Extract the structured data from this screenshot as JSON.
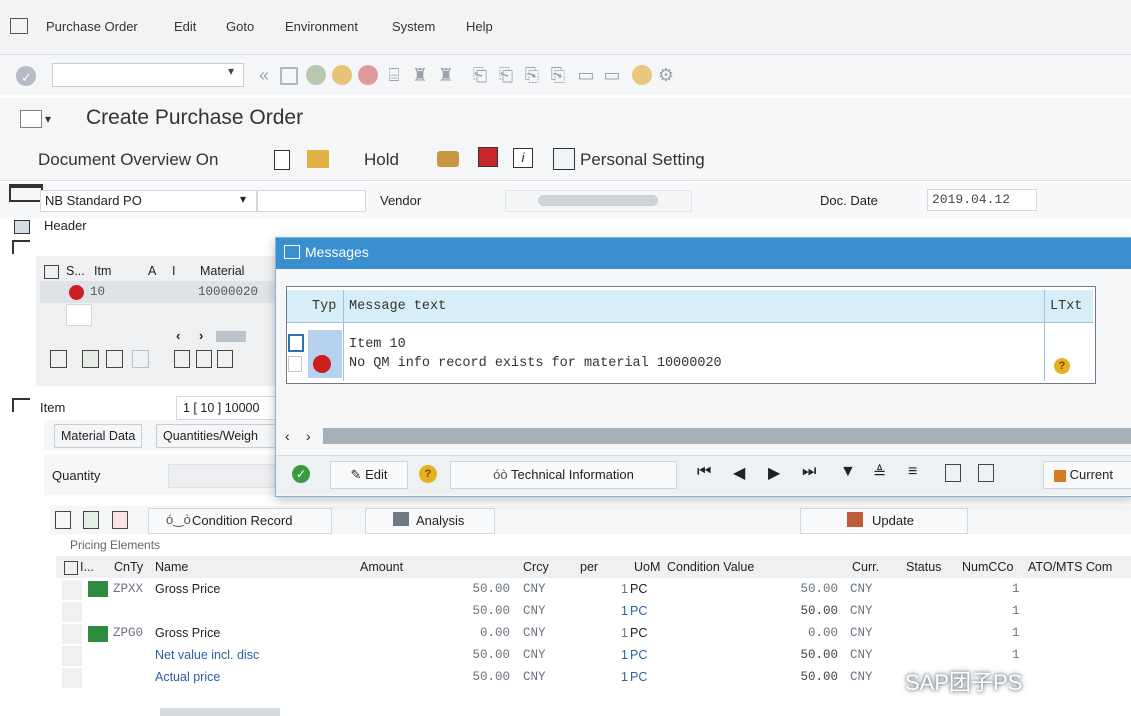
{
  "menu": {
    "items": [
      "Purchase Order",
      "Edit",
      "Goto",
      "Environment",
      "System",
      "Help"
    ]
  },
  "title": "Create Purchase Order",
  "app_toolbar": {
    "doc_overview": "Document Overview On",
    "hold": "Hold",
    "personal_setting": "Personal Setting"
  },
  "header_row": {
    "doc_type": "NB Standard PO",
    "vendor_label": "Vendor",
    "doc_date_label": "Doc. Date",
    "doc_date": "2019.04.12"
  },
  "header_label": "Header",
  "item_grid": {
    "cols": [
      "S...",
      "Itm",
      "A",
      "I",
      "Material"
    ],
    "row_itm": "10",
    "row_material": "10000020"
  },
  "item_section": {
    "label": "Item",
    "selector": "1 [ 10 ] 10000",
    "tabs": [
      "Material Data",
      "Quantities/Weigh"
    ],
    "quantity_label": "Quantity"
  },
  "pricing": {
    "condition_record": "Condition Record",
    "analysis": "Analysis",
    "update": "Update",
    "elements_label": "Pricing Elements",
    "headers": [
      "I...",
      "CnTy",
      "Name",
      "Amount",
      "Crcy",
      "per",
      "UoM",
      "Condition Value",
      "Curr.",
      "Status",
      "NumCCo",
      "ATO/MTS Com"
    ],
    "rows": [
      {
        "cnty": "ZPXX",
        "name": "Gross Price",
        "amount": "50.00",
        "crcy": "CNY",
        "per": "1",
        "uom": "PC",
        "value": "50.00",
        "curr": "CNY",
        "num": "1"
      },
      {
        "cnty": "",
        "name": "",
        "amount": "50.00",
        "crcy": "CNY",
        "per": "1",
        "uom": "PC",
        "value": "50.00",
        "curr": "CNY",
        "num": "1"
      },
      {
        "cnty": "ZPG0",
        "name": "Gross Price",
        "amount": "0.00",
        "crcy": "CNY",
        "per": "1",
        "uom": "PC",
        "value": "0.00",
        "curr": "CNY",
        "num": "1"
      },
      {
        "cnty": "",
        "name": "Net value incl. disc",
        "amount": "50.00",
        "crcy": "CNY",
        "per": "1",
        "uom": "PC",
        "value": "50.00",
        "curr": "CNY",
        "num": "1"
      },
      {
        "cnty": "",
        "name": "Actual price",
        "amount": "50.00",
        "crcy": "CNY",
        "per": "1",
        "uom": "PC",
        "value": "50.00",
        "curr": "CNY",
        "num": "1"
      }
    ]
  },
  "messages": {
    "title": "Messages",
    "col_typ": "Typ",
    "col_text": "Message text",
    "col_ltxt": "LTxt",
    "line1": "Item 10",
    "line2": "No QM info record exists for material 10000020",
    "footer": {
      "edit": "Edit",
      "tech_info": "Technical Information",
      "current": "Current"
    }
  },
  "watermark": "SAP团子PS",
  "colors": {
    "dialog_title": "#3a8fd1",
    "error_red": "#cc1f1f",
    "green_status": "#2e8b3d",
    "msg_header": "#d7edf7"
  }
}
